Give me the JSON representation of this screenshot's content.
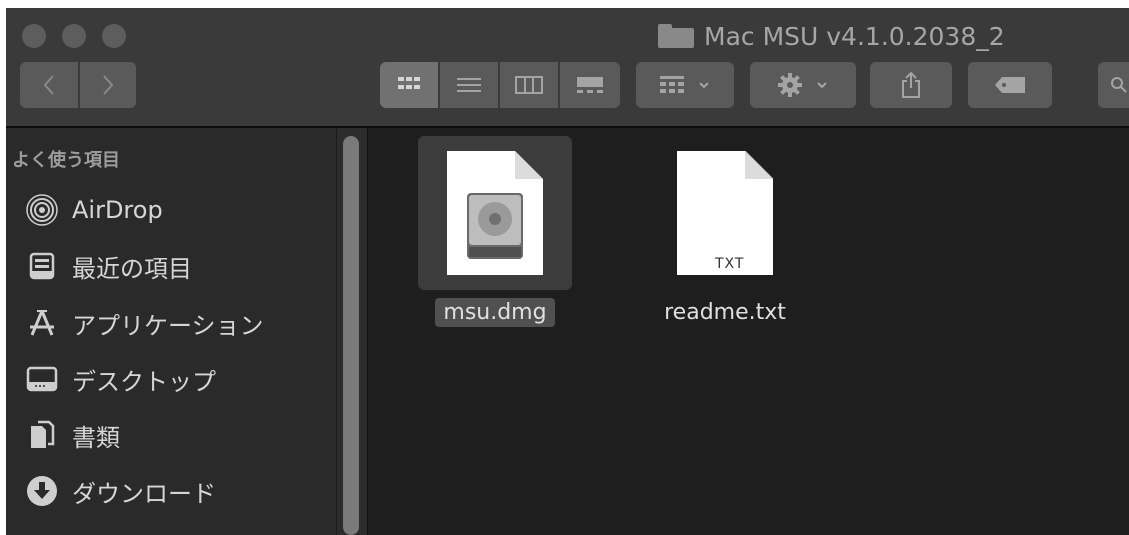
{
  "window": {
    "title": "Mac MSU v4.1.0.2038_2"
  },
  "toolbar": {
    "back_icon": "chevron-left-icon",
    "forward_icon": "chevron-right-icon",
    "view_modes": [
      "icon-view",
      "list-view",
      "column-view",
      "gallery-view"
    ],
    "active_view": "icon-view",
    "group_icon": "group-by-icon",
    "action_icon": "gear-icon",
    "share_icon": "share-icon",
    "tag_icon": "tag-icon"
  },
  "sidebar": {
    "section_title": "よく使う項目",
    "items": [
      {
        "label": "AirDrop",
        "icon": "airdrop-icon"
      },
      {
        "label": "最近の項目",
        "icon": "recents-icon"
      },
      {
        "label": "アプリケーション",
        "icon": "applications-icon"
      },
      {
        "label": "デスクトップ",
        "icon": "desktop-icon"
      },
      {
        "label": "書類",
        "icon": "documents-icon"
      },
      {
        "label": "ダウンロード",
        "icon": "downloads-icon"
      }
    ]
  },
  "files": [
    {
      "name": "msu.dmg",
      "type": "dmg",
      "selected": true
    },
    {
      "name": "readme.txt",
      "type": "txt",
      "badge": "TXT",
      "selected": false
    }
  ],
  "colors": {
    "window_bg": "#1e1e1e",
    "titlebar_bg": "#3b3a3b",
    "sidebar_bg": "#2b2a2b",
    "selection_bg": "#505050"
  }
}
